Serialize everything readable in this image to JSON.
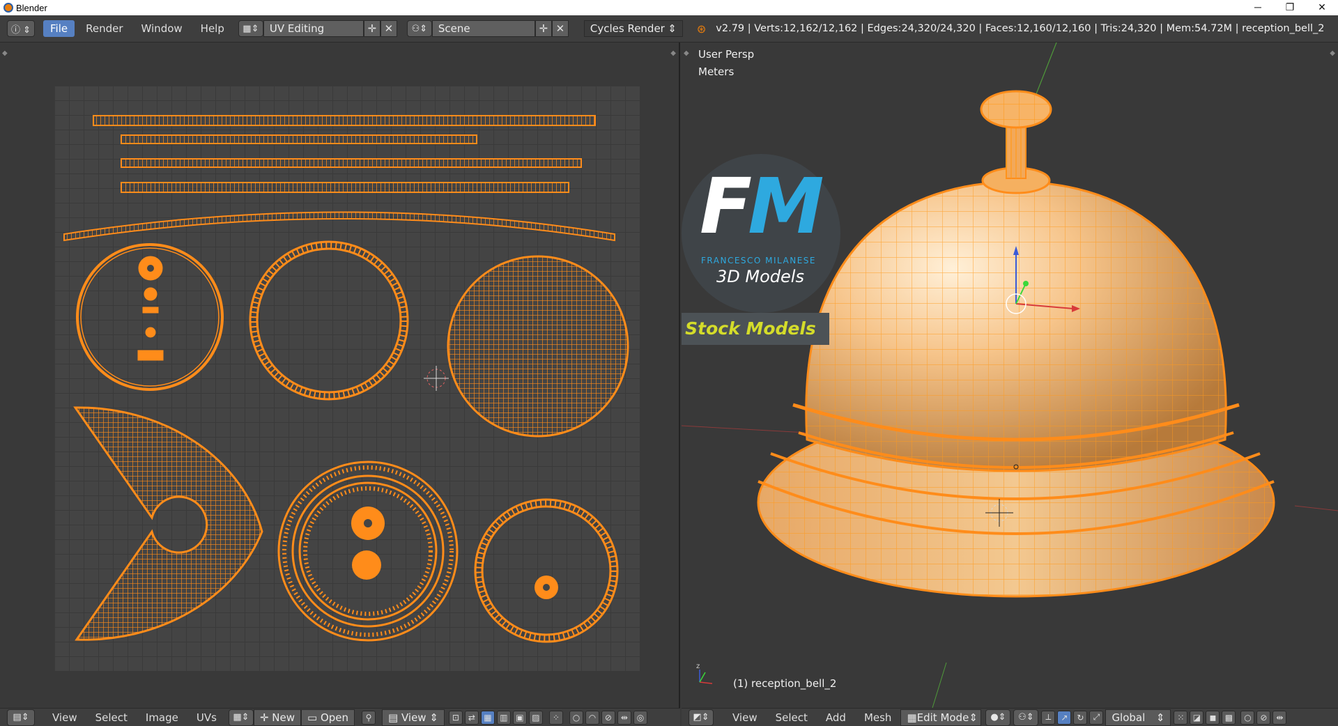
{
  "window": {
    "title": "Blender",
    "controls": [
      "─",
      "❐",
      "✕"
    ]
  },
  "topbar": {
    "info_icon": "info-icon",
    "menus": [
      "File",
      "Render",
      "Window",
      "Help"
    ],
    "active_menu": "File",
    "screen_layout": "UV Editing",
    "scene": "Scene",
    "render_engine": "Cycles Render",
    "stats": "v2.79 | Verts:12,162/12,162 | Edges:24,320/24,320 | Faces:12,160/12,160 | Tris:24,320 | Mem:54.72M | reception_bell_2"
  },
  "uv_editor": {
    "menus": [
      "View",
      "Select",
      "Image",
      "UVs"
    ],
    "new_label": "New",
    "open_label": "Open",
    "view_label": "View"
  },
  "viewport": {
    "view_label": "User Persp",
    "units_label": "Meters",
    "object_label": "(1) reception_bell_2",
    "menus": [
      "View",
      "Select",
      "Add",
      "Mesh"
    ],
    "mode": "Edit Mode",
    "orientation": "Global"
  },
  "logo": {
    "letter_f": "F",
    "letter_m": "M",
    "brand": "FRANCESCO MILANESE",
    "tagline": "3D Models",
    "badge": "Stock Models"
  },
  "colors": {
    "accent": "#5680c2",
    "uv_orange": "#ff8c1a",
    "logo_blue": "#2ea9df",
    "logo_yellow": "#d4dc2a"
  }
}
